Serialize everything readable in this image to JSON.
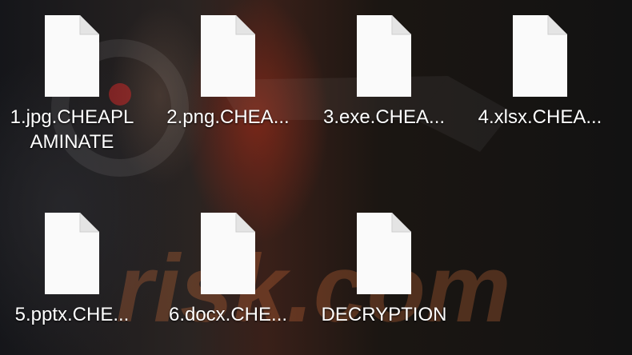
{
  "desktop": {
    "watermark_text": "risk.com",
    "files": [
      {
        "label": "1.jpg.CHEAPLAMINATE",
        "icon": "blank-document-icon"
      },
      {
        "label": "2.png.CHEA...",
        "icon": "blank-document-icon"
      },
      {
        "label": "3.exe.CHEA...",
        "icon": "blank-document-icon"
      },
      {
        "label": "4.xlsx.CHEA...",
        "icon": "blank-document-icon"
      },
      {
        "label": "5.pptx.CHE...",
        "icon": "blank-document-icon"
      },
      {
        "label": "6.docx.CHE...",
        "icon": "blank-document-icon"
      },
      {
        "label": "DECRYPTION",
        "icon": "blank-document-icon"
      }
    ]
  }
}
